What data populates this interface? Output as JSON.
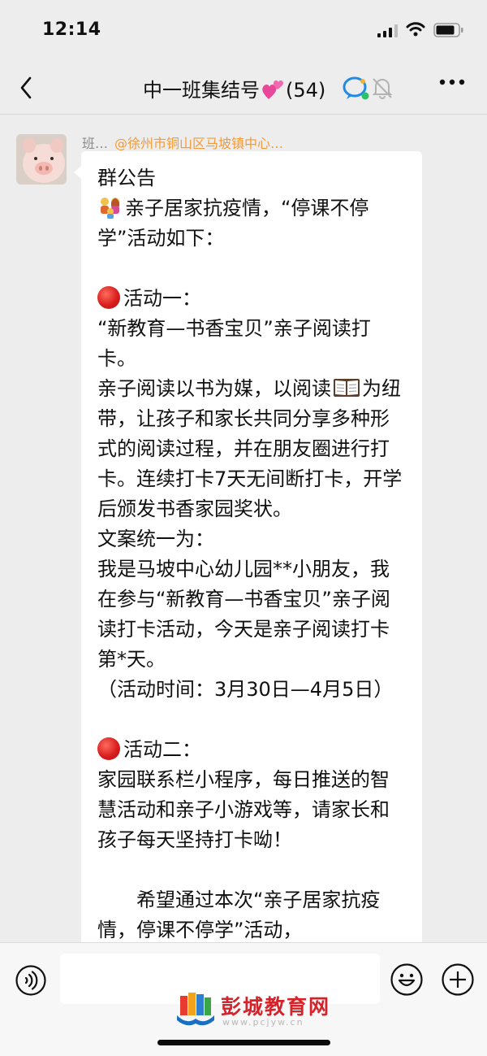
{
  "status": {
    "time": "12:14"
  },
  "nav": {
    "title": "中一班集结号",
    "count": "(54)"
  },
  "chat": {
    "sender_name": "班…",
    "mention": "@徐州市铜山区马坡镇中心…",
    "message": {
      "line1": "群公告",
      "intro": "亲子居家抗疫情，“停课不停学”活动如下：",
      "act1_title": "活动一：",
      "act1_name": "“新教育—书香宝贝”亲子阅读打卡。",
      "act1_desc_a": "亲子阅读以书为媒，以阅读",
      "act1_desc_b": "为纽带，让孩子和家长共同分享多种形式的阅读过程，并在朋友圈进行打卡。连续打卡7天无间断打卡，开学后颁发书香家园奖状。",
      "copy_label": "文案统一为：",
      "copy_text": "我是马坡中心幼儿园**小朋友，我在参与“新教育—书香宝贝”亲子阅读打卡活动，今天是亲子阅读打卡第*天。",
      "act_time": "（活动时间：3月30日—4月5日）",
      "act2_title": "活动二：",
      "act2_desc": "家园联系栏小程序，每日推送的智慧活动和亲子小游戏等，请家长和孩子每天坚持打卡呦！",
      "closing": "希望通过本次“亲子居家抗疫情，停课不停学”活动，"
    }
  },
  "watermark": {
    "name": "彭城教育网",
    "url": "www.pcjyw.cn"
  },
  "colors": {
    "background": "#ededed",
    "bubble": "#ffffff",
    "mention": "#f29b38",
    "brand": "#d4232a"
  },
  "icons": [
    "back-icon",
    "chat-bubble-icon",
    "mute-bell-icon",
    "more-icon",
    "voice-icon",
    "emoji-icon",
    "plus-icon"
  ]
}
